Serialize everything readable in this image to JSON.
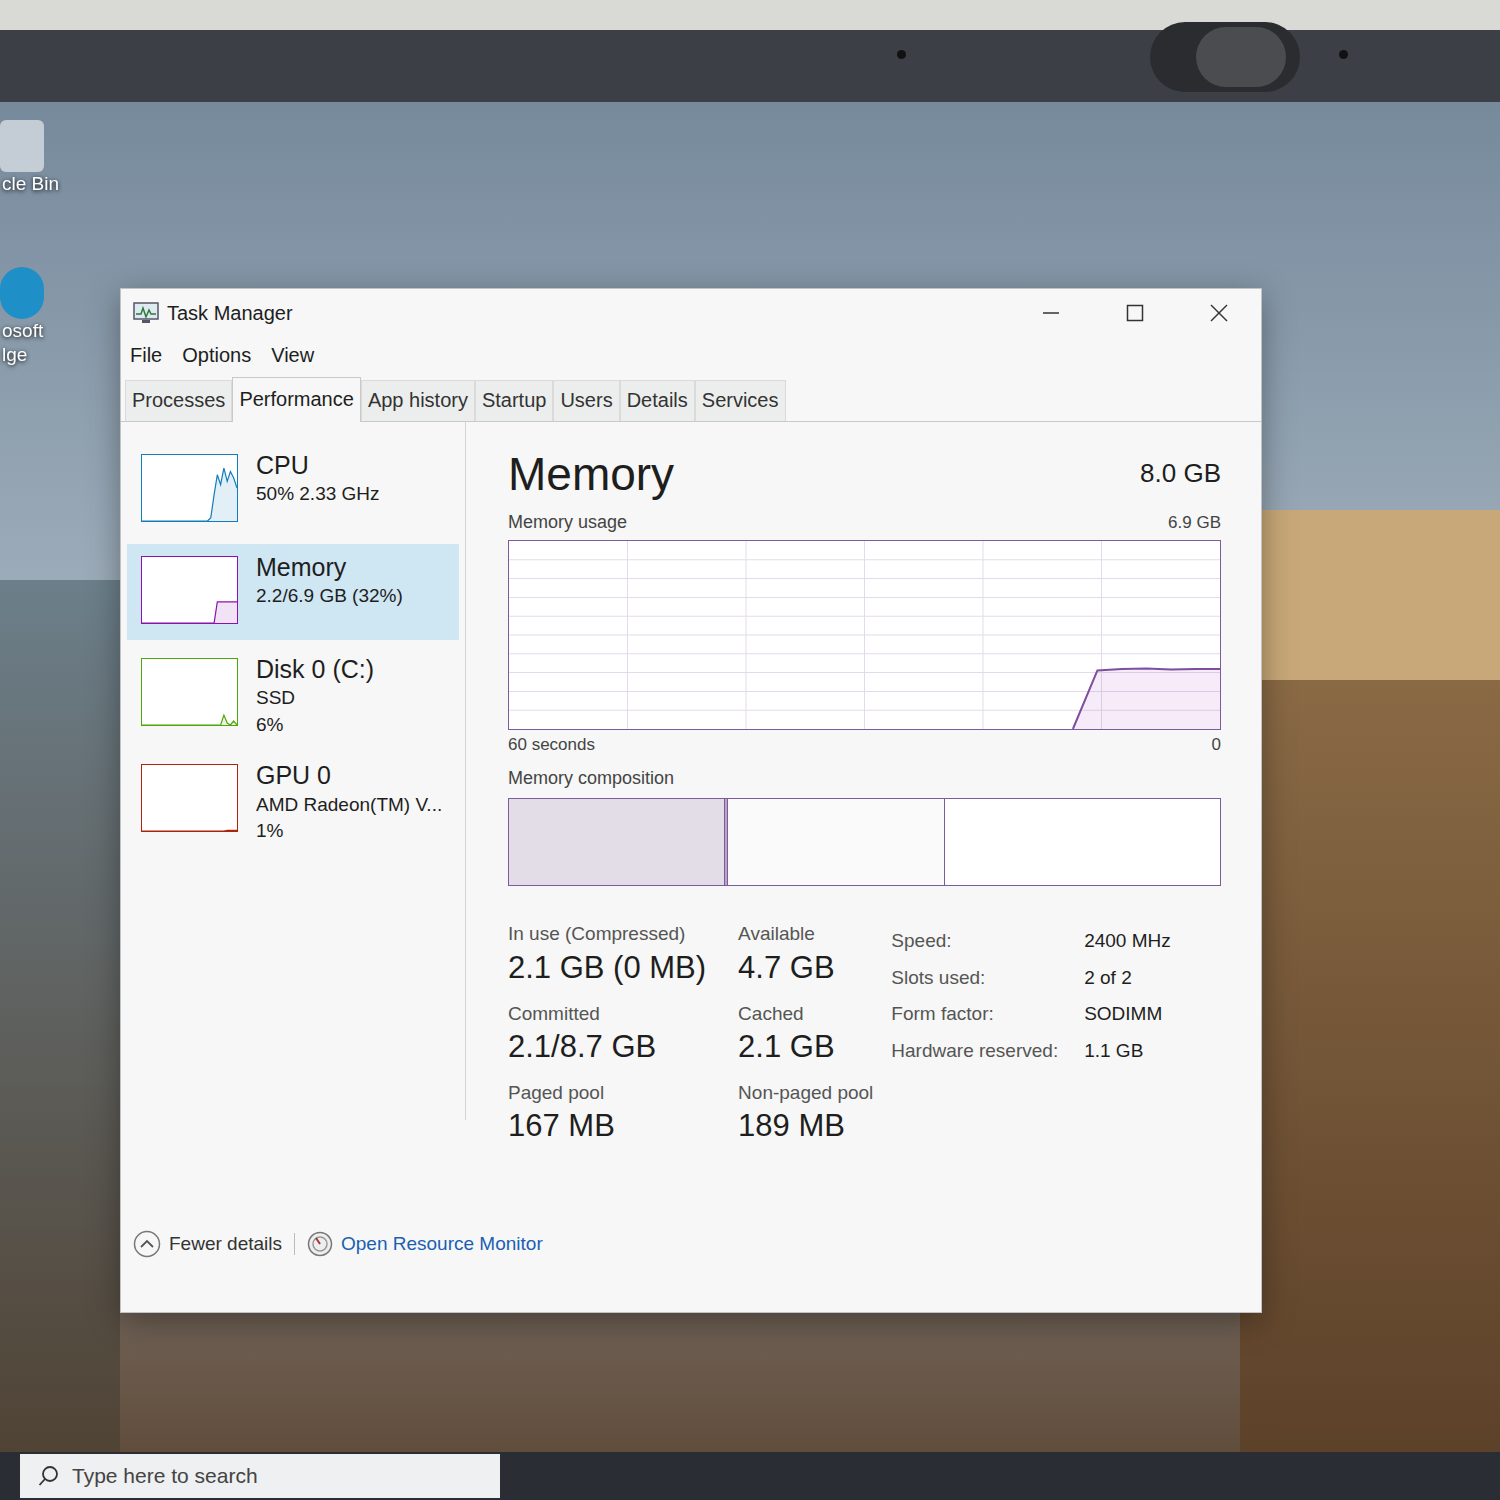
{
  "window": {
    "title": "Task Manager"
  },
  "menu": [
    "File",
    "Options",
    "View"
  ],
  "tabs": [
    {
      "label": "Processes",
      "selected": false
    },
    {
      "label": "Performance",
      "selected": true
    },
    {
      "label": "App history",
      "selected": false
    },
    {
      "label": "Startup",
      "selected": false
    },
    {
      "label": "Users",
      "selected": false
    },
    {
      "label": "Details",
      "selected": false
    },
    {
      "label": "Services",
      "selected": false
    }
  ],
  "sidebar": {
    "items": [
      {
        "name": "CPU",
        "details": [
          "50% 2.33 GHz"
        ],
        "selected": false,
        "color": "#117dbb",
        "graph": [
          0,
          0,
          0,
          0,
          0,
          0,
          0,
          0,
          0,
          0,
          0,
          0,
          0,
          0,
          0,
          0,
          0,
          0,
          0,
          0,
          0,
          5,
          40,
          70,
          55,
          80,
          60,
          75,
          65,
          50
        ]
      },
      {
        "name": "Memory",
        "details": [
          "2.2/6.9 GB (32%)"
        ],
        "selected": true,
        "color": "#8b12ae",
        "graph": [
          0,
          0,
          0,
          0,
          0,
          0,
          0,
          0,
          0,
          0,
          0,
          0,
          0,
          0,
          0,
          0,
          0,
          0,
          0,
          0,
          0,
          0,
          0,
          32,
          32,
          32,
          32,
          32,
          32,
          32
        ]
      },
      {
        "name": "Disk 0 (C:)",
        "details": [
          "SSD",
          "6%"
        ],
        "selected": false,
        "color": "#4da60c",
        "graph": [
          0,
          0,
          0,
          0,
          0,
          0,
          0,
          0,
          0,
          0,
          0,
          0,
          0,
          0,
          0,
          0,
          0,
          0,
          0,
          0,
          0,
          0,
          0,
          0,
          0,
          15,
          3,
          0,
          6,
          0
        ]
      },
      {
        "name": "GPU 0",
        "details": [
          "AMD Radeon(TM) V...",
          "1%"
        ],
        "selected": false,
        "color": "#ab2410",
        "graph": [
          0,
          0,
          0,
          0,
          0,
          0,
          0,
          0,
          0,
          0,
          0,
          0,
          0,
          0,
          0,
          0,
          0,
          0,
          0,
          0,
          0,
          0,
          0,
          0,
          0,
          0,
          1,
          1,
          1,
          1
        ]
      }
    ]
  },
  "memory": {
    "title": "Memory",
    "total": "8.0 GB",
    "usage_label": "Memory usage",
    "usage_max": "6.9 GB",
    "axis_left": "60 seconds",
    "axis_right": "0",
    "usage_values": [
      0,
      0,
      0,
      0,
      0,
      0,
      0,
      0,
      0,
      0,
      0,
      0,
      0,
      0,
      0,
      0,
      0,
      0,
      0,
      0,
      0,
      0,
      0,
      0,
      2.15,
      2.2,
      2.22,
      2.18,
      2.2,
      2.2
    ],
    "usage_axis_max": 6.9,
    "composition_label": "Memory composition",
    "composition": [
      {
        "kind": "in-use",
        "gb": 2.1
      },
      {
        "kind": "modified",
        "gb": 0.03
      },
      {
        "kind": "standby",
        "gb": 2.1
      },
      {
        "kind": "free",
        "gb": 2.67
      }
    ],
    "stats": [
      {
        "label": "In use (Compressed)",
        "value": "2.1 GB (0 MB)"
      },
      {
        "label": "Available",
        "value": "4.7 GB"
      },
      {
        "label": "Committed",
        "value": "2.1/8.7 GB"
      },
      {
        "label": "Cached",
        "value": "2.1 GB"
      },
      {
        "label": "Paged pool",
        "value": "167 MB"
      },
      {
        "label": "Non-paged pool",
        "value": "189 MB"
      }
    ],
    "specs": [
      {
        "label": "Speed:",
        "value": "2400 MHz"
      },
      {
        "label": "Slots used:",
        "value": "2 of 2"
      },
      {
        "label": "Form factor:",
        "value": "SODIMM"
      },
      {
        "label": "Hardware reserved:",
        "value": "1.1 GB"
      }
    ]
  },
  "footer": {
    "fewer_details": "Fewer details",
    "resource_monitor": "Open Resource Monitor"
  },
  "desktop_icons": [
    {
      "lines": [
        "cle Bin"
      ]
    },
    {
      "lines": [
        "osoft",
        "lge"
      ]
    }
  ],
  "taskbar": {
    "search_placeholder": "Type here to search"
  }
}
